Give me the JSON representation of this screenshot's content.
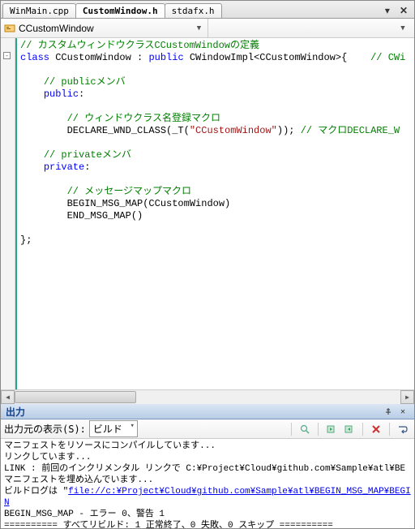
{
  "tabs": {
    "items": [
      "WinMain.cpp",
      "CustomWindow.h",
      "stdafx.h"
    ],
    "active_index": 1
  },
  "nav": {
    "scope": "CCustomWindow",
    "member": ""
  },
  "code": {
    "lines": [
      {
        "indent": 0,
        "spans": [
          {
            "cls": "c-comment",
            "t": "// カスタムウィンドウクラスCCustomWindowの定義"
          }
        ]
      },
      {
        "indent": 0,
        "spans": [
          {
            "cls": "c-key",
            "t": "class"
          },
          {
            "cls": "",
            "t": " CCustomWindow : "
          },
          {
            "cls": "c-key",
            "t": "public"
          },
          {
            "cls": "",
            "t": " CWindowImpl<CCustomWindow>{    "
          },
          {
            "cls": "c-comment",
            "t": "// CWi"
          }
        ]
      },
      {
        "indent": 0,
        "spans": [
          {
            "cls": "",
            "t": ""
          }
        ]
      },
      {
        "indent": 1,
        "spans": [
          {
            "cls": "c-comment",
            "t": "// publicメンバ"
          }
        ]
      },
      {
        "indent": 1,
        "spans": [
          {
            "cls": "c-key",
            "t": "public"
          },
          {
            "cls": "",
            "t": ":"
          }
        ]
      },
      {
        "indent": 0,
        "spans": [
          {
            "cls": "",
            "t": ""
          }
        ]
      },
      {
        "indent": 2,
        "spans": [
          {
            "cls": "c-comment",
            "t": "// ウィンドウクラス名登録マクロ"
          }
        ]
      },
      {
        "indent": 2,
        "spans": [
          {
            "cls": "",
            "t": "DECLARE_WND_CLASS(_T("
          },
          {
            "cls": "c-str",
            "t": "\"CCustomWindow\""
          },
          {
            "cls": "",
            "t": ")); "
          },
          {
            "cls": "c-comment",
            "t": "// マクロDECLARE_W"
          }
        ]
      },
      {
        "indent": 0,
        "spans": [
          {
            "cls": "",
            "t": ""
          }
        ]
      },
      {
        "indent": 1,
        "spans": [
          {
            "cls": "c-comment",
            "t": "// privateメンバ"
          }
        ]
      },
      {
        "indent": 1,
        "spans": [
          {
            "cls": "c-key",
            "t": "private"
          },
          {
            "cls": "",
            "t": ":"
          }
        ]
      },
      {
        "indent": 0,
        "spans": [
          {
            "cls": "",
            "t": ""
          }
        ]
      },
      {
        "indent": 2,
        "spans": [
          {
            "cls": "c-comment",
            "t": "// メッセージマップマクロ"
          }
        ]
      },
      {
        "indent": 2,
        "spans": [
          {
            "cls": "",
            "t": "BEGIN_MSG_MAP(CCustomWindow)"
          }
        ]
      },
      {
        "indent": 2,
        "spans": [
          {
            "cls": "",
            "t": "END_MSG_MAP()"
          }
        ]
      },
      {
        "indent": 0,
        "spans": [
          {
            "cls": "",
            "t": ""
          }
        ]
      },
      {
        "indent": 0,
        "spans": [
          {
            "cls": "",
            "t": "};"
          }
        ]
      }
    ]
  },
  "output_panel": {
    "title": "出力",
    "source_label": "出力元の表示(S):",
    "source_value": "ビルド",
    "lines": [
      "マニフェストをリソースにコンパイルしています...",
      "リンクしています...",
      "LINK : 前回のインクリメンタル リンクで C:¥Project¥Cloud¥github.com¥Sample¥atl¥BE",
      "マニフェストを埋め込んでいます...",
      {
        "pre": "ビルドログは \"",
        "link": "file://c:¥Project¥Cloud¥github.com¥Sample¥atl¥BEGIN_MSG_MAP¥BEGIN",
        "post": ""
      },
      "BEGIN_MSG_MAP - エラー 0、警告 1",
      "========== すべてリビルド: 1 正常終了、0 失敗、0 スキップ ==========",
      ""
    ]
  }
}
